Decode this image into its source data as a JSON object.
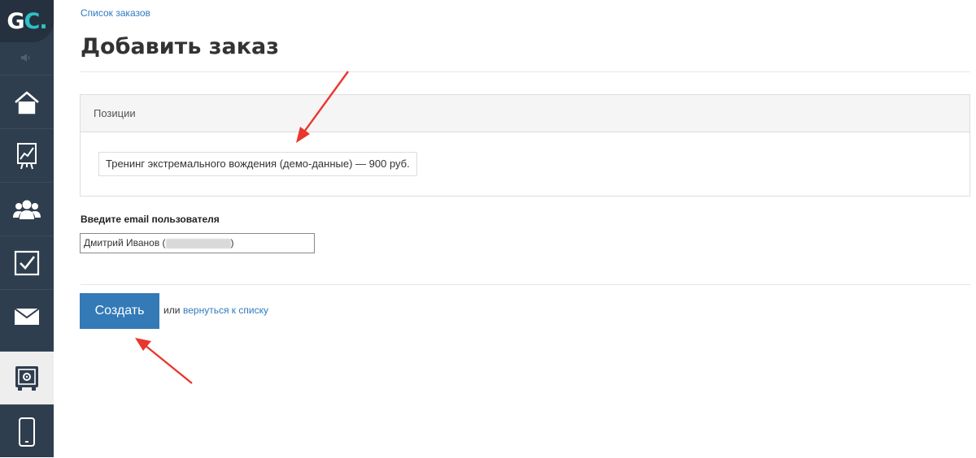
{
  "sidebar": {
    "logo": {
      "main": "G",
      "accent": "C."
    },
    "items": [
      {
        "name": "home",
        "icon": "home-icon"
      },
      {
        "name": "reports",
        "icon": "chart-icon"
      },
      {
        "name": "users",
        "icon": "users-icon"
      },
      {
        "name": "tasks",
        "icon": "checkbox-icon"
      },
      {
        "name": "messages",
        "icon": "mail-icon"
      },
      {
        "name": "sales",
        "icon": "safe-icon",
        "active": true
      },
      {
        "name": "mobile",
        "icon": "phone-icon"
      }
    ]
  },
  "breadcrumb": {
    "label": "Список заказов"
  },
  "page": {
    "title": "Добавить заказ"
  },
  "positions": {
    "header": "Позиции",
    "items": [
      "Тренинг экстремального вождения (демо-данные) — 900 руб."
    ]
  },
  "email": {
    "label": "Введите email пользователя",
    "value_prefix": "Дмитрий  Иванов (",
    "value_suffix": ")"
  },
  "actions": {
    "create_label": "Создать",
    "or_text": "или",
    "back_link": "вернуться к списку"
  },
  "colors": {
    "sidebar": "#2f3e4e",
    "accent": "#2dc1c8",
    "primary": "#337ab7",
    "link": "#2e7bbf",
    "annotation": "#e8372c"
  }
}
